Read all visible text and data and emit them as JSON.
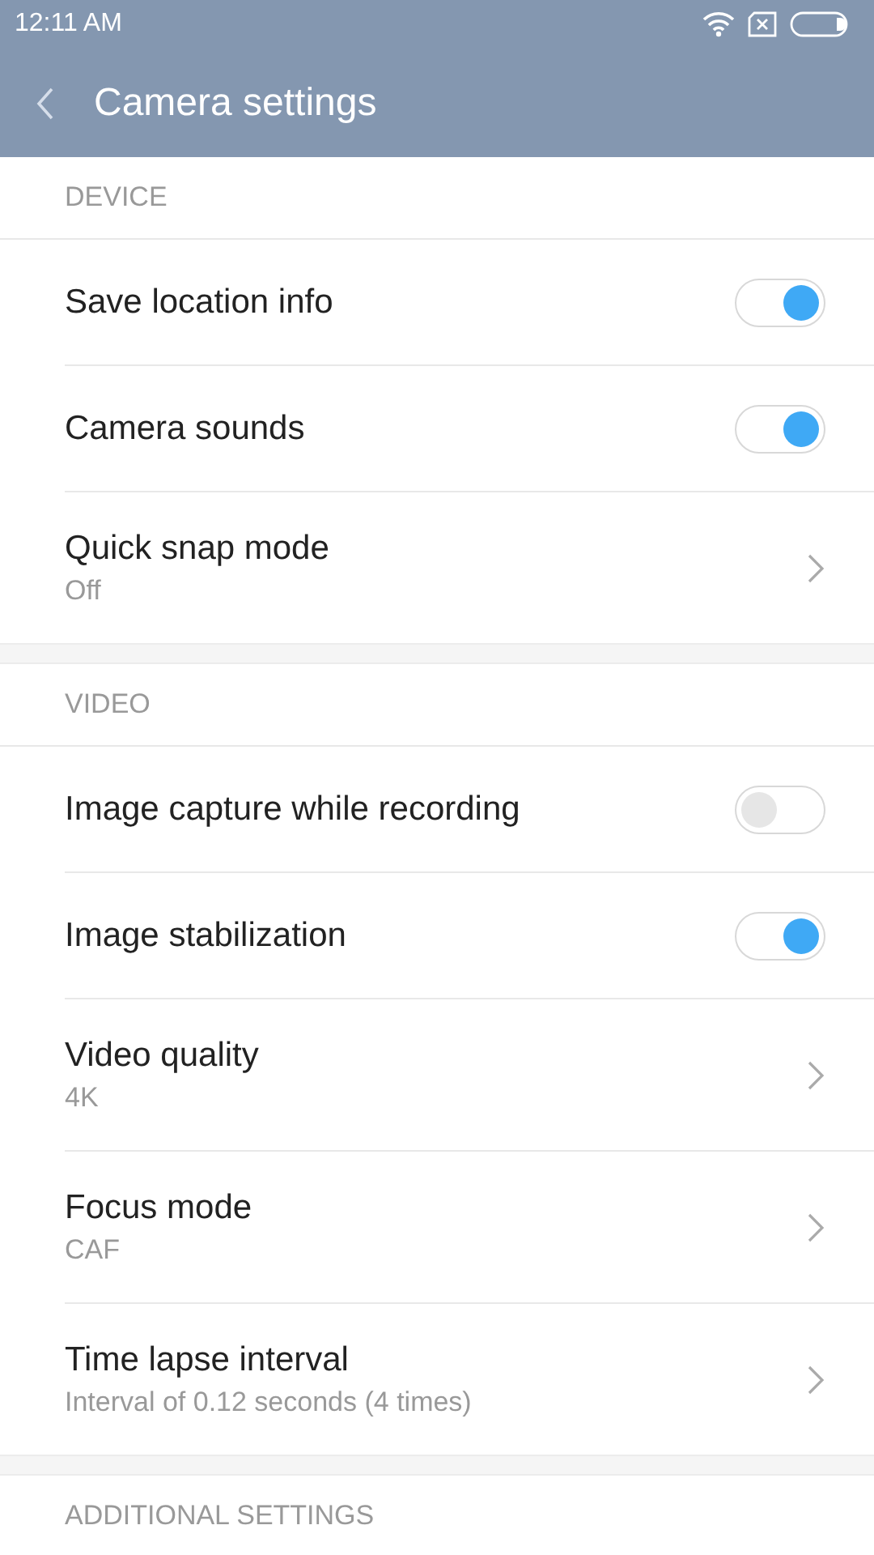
{
  "status_bar": {
    "time": "12:11 AM"
  },
  "header": {
    "title": "Camera settings"
  },
  "sections": [
    {
      "title": "DEVICE",
      "items": [
        {
          "kind": "toggle",
          "label": "Save location info",
          "on": true
        },
        {
          "kind": "toggle",
          "label": "Camera sounds",
          "on": true
        },
        {
          "kind": "link",
          "label": "Quick snap mode",
          "value": "Off"
        }
      ]
    },
    {
      "title": "VIDEO",
      "items": [
        {
          "kind": "toggle",
          "label": "Image capture while recording",
          "on": false
        },
        {
          "kind": "toggle",
          "label": "Image stabilization",
          "on": true
        },
        {
          "kind": "link",
          "label": "Video quality",
          "value": "4K"
        },
        {
          "kind": "link",
          "label": "Focus mode",
          "value": "CAF"
        },
        {
          "kind": "link",
          "label": "Time lapse interval",
          "value": "Interval of 0.12 seconds (4 times)"
        }
      ]
    },
    {
      "title": "ADDITIONAL SETTINGS"
    }
  ]
}
